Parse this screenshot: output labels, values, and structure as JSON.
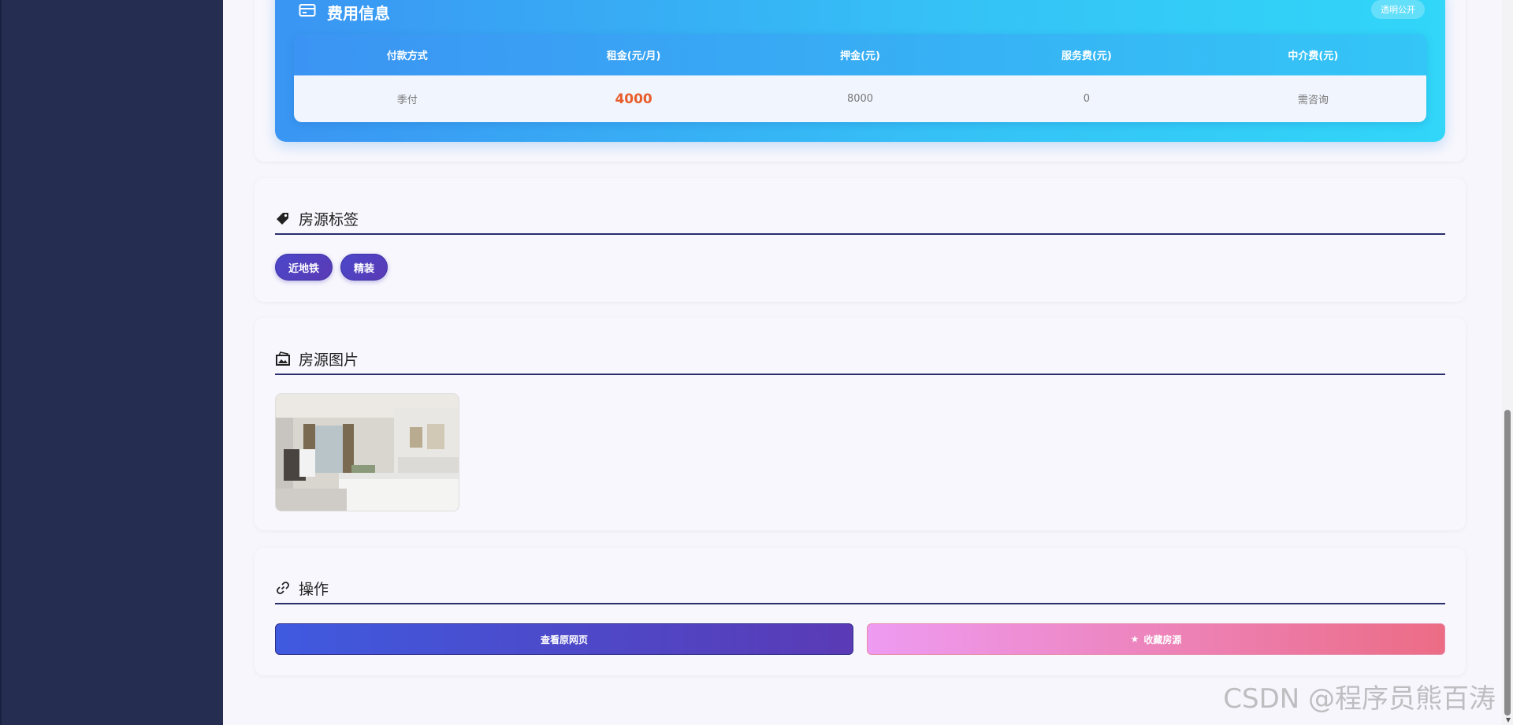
{
  "fee": {
    "title": "费用信息",
    "badge": "透明公开",
    "headers": [
      "付款方式",
      "租金(元/月)",
      "押金(元)",
      "服务费(元)",
      "中介费(元)"
    ],
    "values": [
      "季付",
      "4000",
      "8000",
      "0",
      "需咨询"
    ]
  },
  "tags": {
    "title": "房源标签",
    "items": [
      "近地铁",
      "精装"
    ]
  },
  "images": {
    "title": "房源图片"
  },
  "ops": {
    "title": "操作",
    "view_label": "查看原网页",
    "fav_icon": "★",
    "fav_label": "收藏房源"
  },
  "watermark": "CSDN @程序员熊百涛",
  "colors": {
    "sidebar": "#252e50",
    "fee_gradient_start": "#3a95f3",
    "fee_gradient_end": "#31d6f8",
    "rent": "#e85d2c",
    "tag": "#4b47c9"
  }
}
